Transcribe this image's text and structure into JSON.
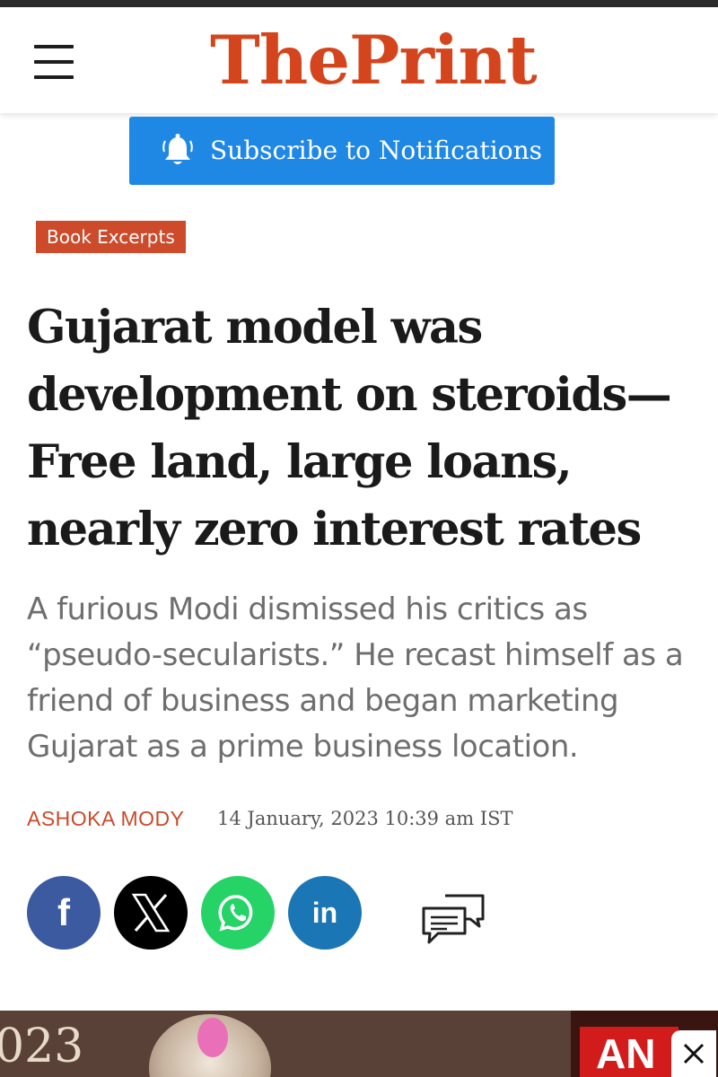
{
  "header": {
    "logo_text": "ThePrint",
    "menu_icon": "hamburger-menu-icon",
    "brand_color": "#d4451e"
  },
  "subscribe": {
    "label": "Subscribe to Notifications",
    "icon": "bell-icon",
    "color": "#1f88e5"
  },
  "article": {
    "category": "Book Excerpts",
    "headline": "Gujarat model was development on steroids—Free land, large loans, nearly zero interest rates",
    "dek": "A furious Modi dismissed his critics as “pseudo-secularists.” He recast himself as a friend of business and began marketing Gujarat as a prime business location.",
    "author": "ASHOKA MODY",
    "date": "14 January, 2023 10:39 am IST"
  },
  "share": {
    "facebook_glyph": "f",
    "linkedin_glyph": "in",
    "icons": [
      "facebook-icon",
      "x-icon",
      "whatsapp-icon",
      "linkedin-icon",
      "comments-icon"
    ]
  },
  "ad": {
    "year_fragment": "023",
    "logo_fragment": "AN",
    "close_glyph": "✕"
  }
}
